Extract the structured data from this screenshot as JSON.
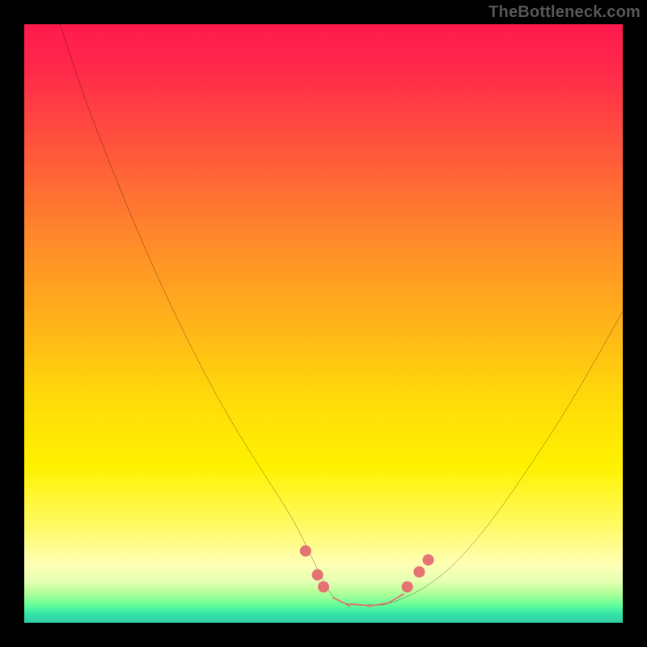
{
  "watermark": "TheBottleneck.com",
  "colors": {
    "frame": "#000000",
    "curve": "#000000",
    "markers": "#e57373",
    "gradient_top": "#ff1a4d",
    "gradient_mid": "#fff200",
    "gradient_bottom": "#33cca6"
  },
  "chart_data": {
    "type": "line",
    "title": "",
    "xlabel": "",
    "ylabel": "",
    "xlim": [
      0,
      100
    ],
    "ylim": [
      0,
      100
    ],
    "note": "V-shaped bottleneck curve over a heat gradient. No numeric tick labels are present in the image; x/y are normalized 0–100. Lower y values (curve minimum) sit in the green band.",
    "series": [
      {
        "name": "bottleneck-curve",
        "x": [
          6,
          10,
          15,
          20,
          25,
          30,
          35,
          40,
          45,
          48,
          50,
          52,
          55,
          58,
          60,
          63,
          67,
          72,
          78,
          85,
          92,
          100
        ],
        "values": [
          100,
          88,
          75,
          63,
          52,
          42,
          33,
          25,
          17,
          11,
          7,
          4,
          3,
          3,
          3,
          4,
          6,
          10,
          17,
          27,
          38,
          52
        ]
      }
    ],
    "markers": {
      "name": "highlighted-points",
      "description": "Salmon dots/segments clustered around the curve minimum",
      "points": [
        {
          "x": 47,
          "y": 12
        },
        {
          "x": 49,
          "y": 8
        },
        {
          "x": 50,
          "y": 6
        },
        {
          "x": 53,
          "y": 3.5
        },
        {
          "x": 56,
          "y": 3
        },
        {
          "x": 59,
          "y": 3
        },
        {
          "x": 62,
          "y": 4
        },
        {
          "x": 64,
          "y": 6
        },
        {
          "x": 66,
          "y": 8.5
        },
        {
          "x": 67.5,
          "y": 10.5
        }
      ]
    }
  }
}
